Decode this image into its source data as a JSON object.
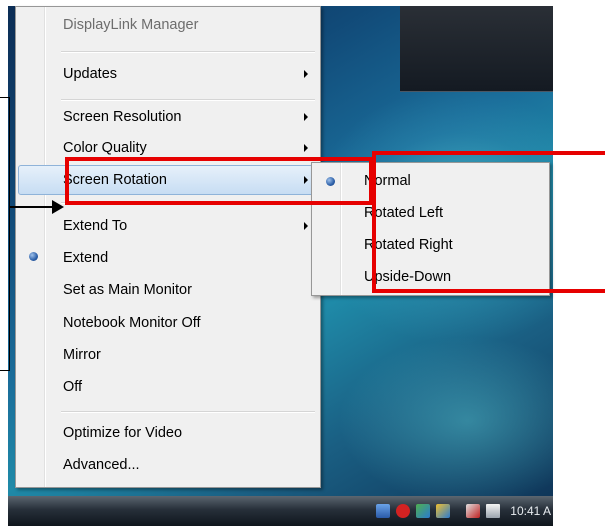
{
  "main_menu": {
    "items": [
      {
        "label": "DisplayLink Manager"
      },
      {
        "label": "Updates"
      },
      {
        "label": "Screen Resolution"
      },
      {
        "label": "Color Quality"
      },
      {
        "label": "Screen Rotation"
      },
      {
        "label": "Extend To"
      },
      {
        "label": "Extend"
      },
      {
        "label": "Set as Main Monitor"
      },
      {
        "label": "Notebook Monitor Off"
      },
      {
        "label": "Mirror"
      },
      {
        "label": "Off"
      },
      {
        "label": "Optimize for Video"
      },
      {
        "label": "Advanced..."
      }
    ]
  },
  "rotation_submenu": {
    "items": [
      {
        "label": "Normal"
      },
      {
        "label": "Rotated Left"
      },
      {
        "label": "Rotated Right"
      },
      {
        "label": "Upside-Down"
      }
    ]
  },
  "taskbar": {
    "clock": "10:41 A"
  }
}
